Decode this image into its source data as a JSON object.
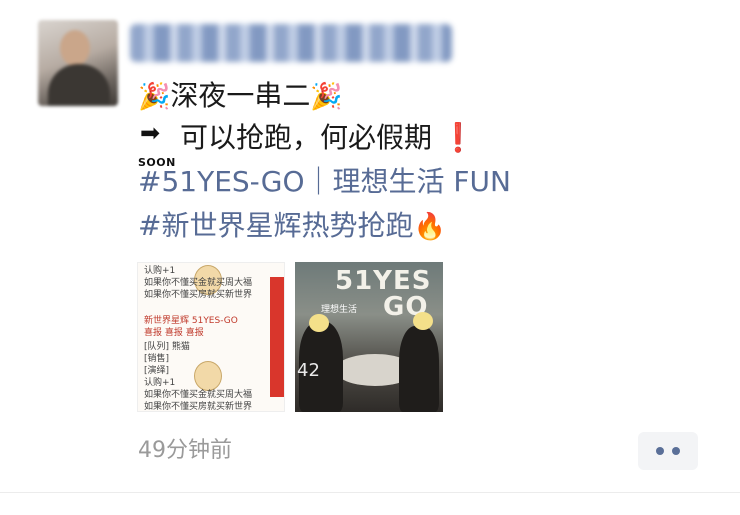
{
  "post": {
    "line1": {
      "party_icon": "🎉",
      "text": "深夜一串二"
    },
    "line2": {
      "arrow_icon": "➡",
      "soon_label": "SOON",
      "text": "可以抢跑，何必假期",
      "exclaim_icon": "❗"
    },
    "line3": {
      "text": "#51YES-GO｜理想生活 FUN"
    },
    "line4": {
      "text": "#新世界星辉热势抢跑",
      "fire_icon": "🔥"
    }
  },
  "images": {
    "image1": {
      "lines": [
        "认购+1",
        "如果你不懂买金就买周大福",
        "如果你不懂买房就买新世界",
        "新世界星辉 51YES-GO",
        "喜报 喜报 喜报",
        "[队列] 熊猫",
        "[销售]",
        "[演绎]",
        "认购+1",
        "如果你不懂买金就买周大福",
        "如果你不懂买房就买新世界"
      ]
    },
    "image2": {
      "title_line1": "51YES",
      "title_line2": "GO",
      "subtitle": "理想生活",
      "time": "42"
    }
  },
  "footer": {
    "timestamp": "49分钟前",
    "more_icon": "more-dots-icon"
  },
  "colors": {
    "link": "#576b95",
    "accent_red": "#e0242a",
    "more_dots": "#5a6f98",
    "time_gray": "#9a9a9a"
  }
}
